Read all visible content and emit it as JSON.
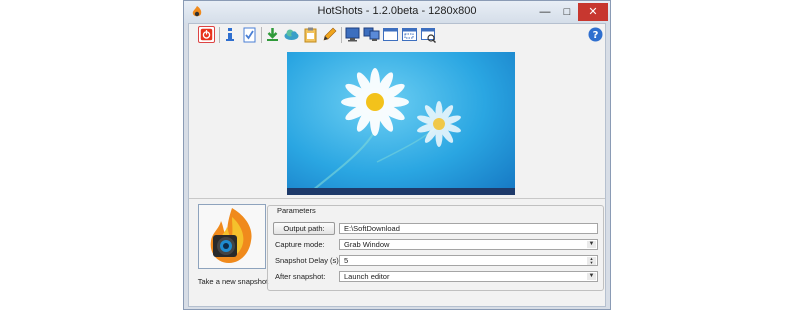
{
  "window": {
    "title": "HotShots - 1.2.0beta - 1280x800"
  },
  "title_controls": {
    "minimize": "—",
    "maximize": "□",
    "close": "✕"
  },
  "toolbar": {
    "buttons": [
      {
        "icon": "power-icon",
        "color": "#e8331c"
      },
      {
        "icon": "info-icon",
        "color": "#2f6fcf"
      },
      {
        "icon": "checklist-icon",
        "color": "#4a7fd4"
      },
      {
        "icon": "download-icon",
        "color": "#2f9a3a"
      },
      {
        "icon": "upload-cloud-icon",
        "color": "#3aa0c8"
      },
      {
        "icon": "clipboard-icon",
        "color": "#e0a41c"
      },
      {
        "icon": "pencil-icon",
        "color": "#e08a1c"
      },
      {
        "icon": "monitor-icon",
        "color": "#3d6fbf"
      },
      {
        "icon": "multi-monitor-icon",
        "color": "#3d6fbf"
      },
      {
        "icon": "window-icon",
        "color": "#3d6fbf"
      },
      {
        "icon": "region-icon",
        "color": "#3d6fbf"
      },
      {
        "icon": "freehand-region-icon",
        "color": "#3d6fbf"
      },
      {
        "icon": "help-icon",
        "color": "#2f6fcf"
      }
    ]
  },
  "snapshot": {
    "label": "Take a new snapshot"
  },
  "params": {
    "legend": "Parameters",
    "output_path_button": "Output path:",
    "output_path_value": "E:\\SoftDownload",
    "capture_mode_label": "Capture mode:",
    "capture_mode_value": "Grab Window",
    "delay_label": "Snapshot Delay (s):",
    "delay_value": "5",
    "after_label": "After snapshot:",
    "after_value": "Launch editor"
  },
  "colors": {
    "close": "#c7372f",
    "sky": "#2aa6e2",
    "taskbar": "#1e3a6a"
  }
}
